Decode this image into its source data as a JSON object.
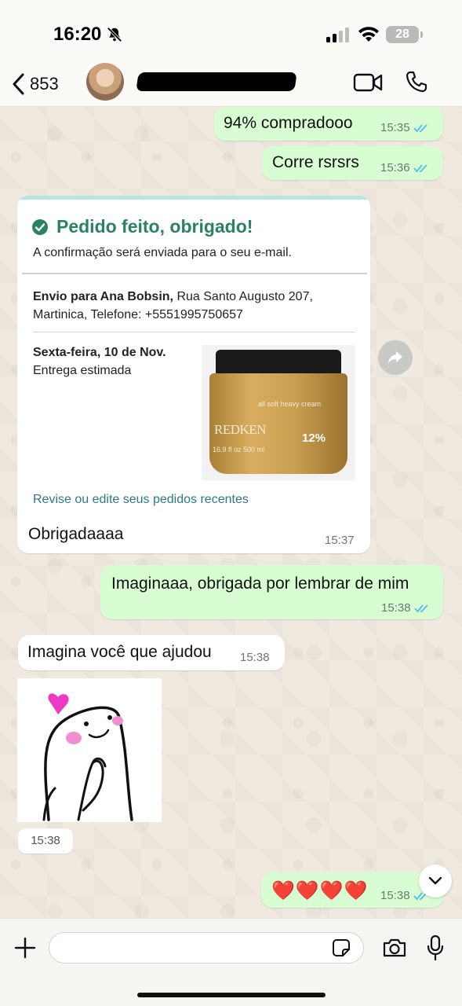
{
  "status_bar": {
    "time": "16:20",
    "battery": "28"
  },
  "header": {
    "back_count": "853",
    "contact_name": ""
  },
  "messages": [
    {
      "dir": "out",
      "text": "94% compradooo",
      "time": "15:35"
    },
    {
      "dir": "out",
      "text": "Corre rsrsrs",
      "time": "15:36"
    }
  ],
  "order_card": {
    "title": "Pedido feito, obrigado!",
    "subtitle": "A confirmação será enviada para o seu e-mail.",
    "ship_label": "Envio para Ana Bobsin,",
    "ship_address": " Rua Santo Augusto 207, Martinica, Telefone: +5551995750657",
    "date": "Sexta-feira, 10 de Nov.",
    "delivery": "Entrega estimada",
    "product": {
      "brand": "REDKEN",
      "line": "all soft heavy cream",
      "size": "16.9 fl oz 500 ml",
      "percent": "12%"
    },
    "review_link": "Revise ou edite seus pedidos recentes",
    "reply_text": "Obrigadaaaa",
    "reply_time": "15:37"
  },
  "messages_after": [
    {
      "dir": "out",
      "text": "Imaginaaa, obrigada por lembrar de mim",
      "time": "15:38"
    },
    {
      "dir": "in",
      "text": "Imagina você que ajudou",
      "time": "15:38"
    }
  ],
  "sticker": {
    "time": "15:38"
  },
  "last_message": {
    "text": "❤️❤️❤️❤️",
    "time": "15:38"
  },
  "composer": {
    "placeholder": ""
  },
  "colors": {
    "outgoing_bubble": "#d9fdd3",
    "incoming_bubble": "#ffffff",
    "read_check": "#53bdeb",
    "order_title": "#2b8263",
    "link": "#2b7a80"
  }
}
